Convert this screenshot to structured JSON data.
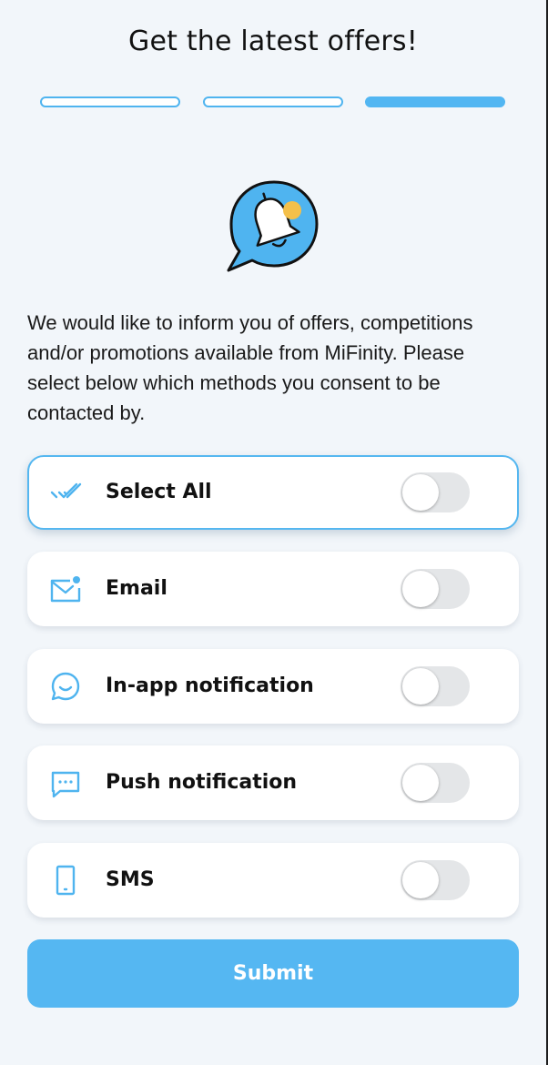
{
  "header": {
    "title": "Get the latest offers!"
  },
  "progress": {
    "total_steps": 3,
    "current_step": 3
  },
  "intro_text": "We would like to inform you of offers, competitions and/or promotions available from MiFinity. Please select below which methods you consent to be contacted by.",
  "options": [
    {
      "label": "Select All",
      "icon": "double-check-icon",
      "enabled": false
    },
    {
      "label": "Email",
      "icon": "envelope-icon",
      "enabled": false
    },
    {
      "label": "In-app notification",
      "icon": "chat-smile-icon",
      "enabled": false
    },
    {
      "label": "Push notification",
      "icon": "message-dots-icon",
      "enabled": false
    },
    {
      "label": "SMS",
      "icon": "phone-icon",
      "enabled": false
    }
  ],
  "submit": {
    "label": "Submit"
  },
  "colors": {
    "accent": "#52b6f2",
    "background": "#f2f6fa",
    "bell": "#ffffff",
    "notification_dot": "#f4c04a"
  }
}
